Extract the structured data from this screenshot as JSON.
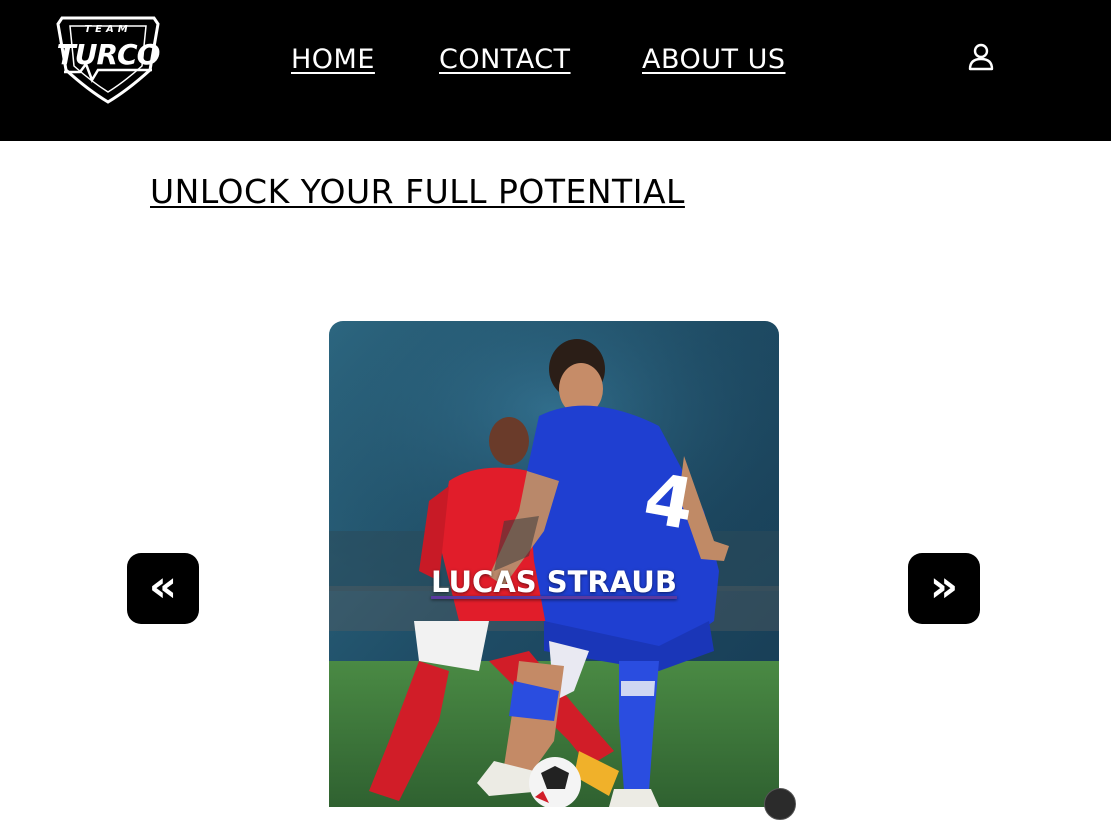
{
  "header": {
    "logo": {
      "top_text": "TEAM",
      "main_text": "TURCO",
      "icon": "shield-logo"
    },
    "nav": [
      {
        "label": "HOME"
      },
      {
        "label": "CONTACT"
      },
      {
        "label": "ABOUT US"
      }
    ],
    "account_icon": "user-icon"
  },
  "main": {
    "headline": "UNLOCK YOUR FULL POTENTIAL",
    "carousel": {
      "current_name": "LUCAS STRAUB",
      "prev_label": "«",
      "next_label": "»",
      "prev_icon": "chevron-double-left-icon",
      "next_icon": "chevron-double-right-icon"
    }
  },
  "colors": {
    "header_bg": "#000000",
    "text_on_dark": "#ffffff",
    "page_bg": "#ffffff",
    "jersey_blue": "#1f3fd1",
    "opponent_red": "#e11d2a",
    "pitch_green": "#3f7a3c"
  }
}
